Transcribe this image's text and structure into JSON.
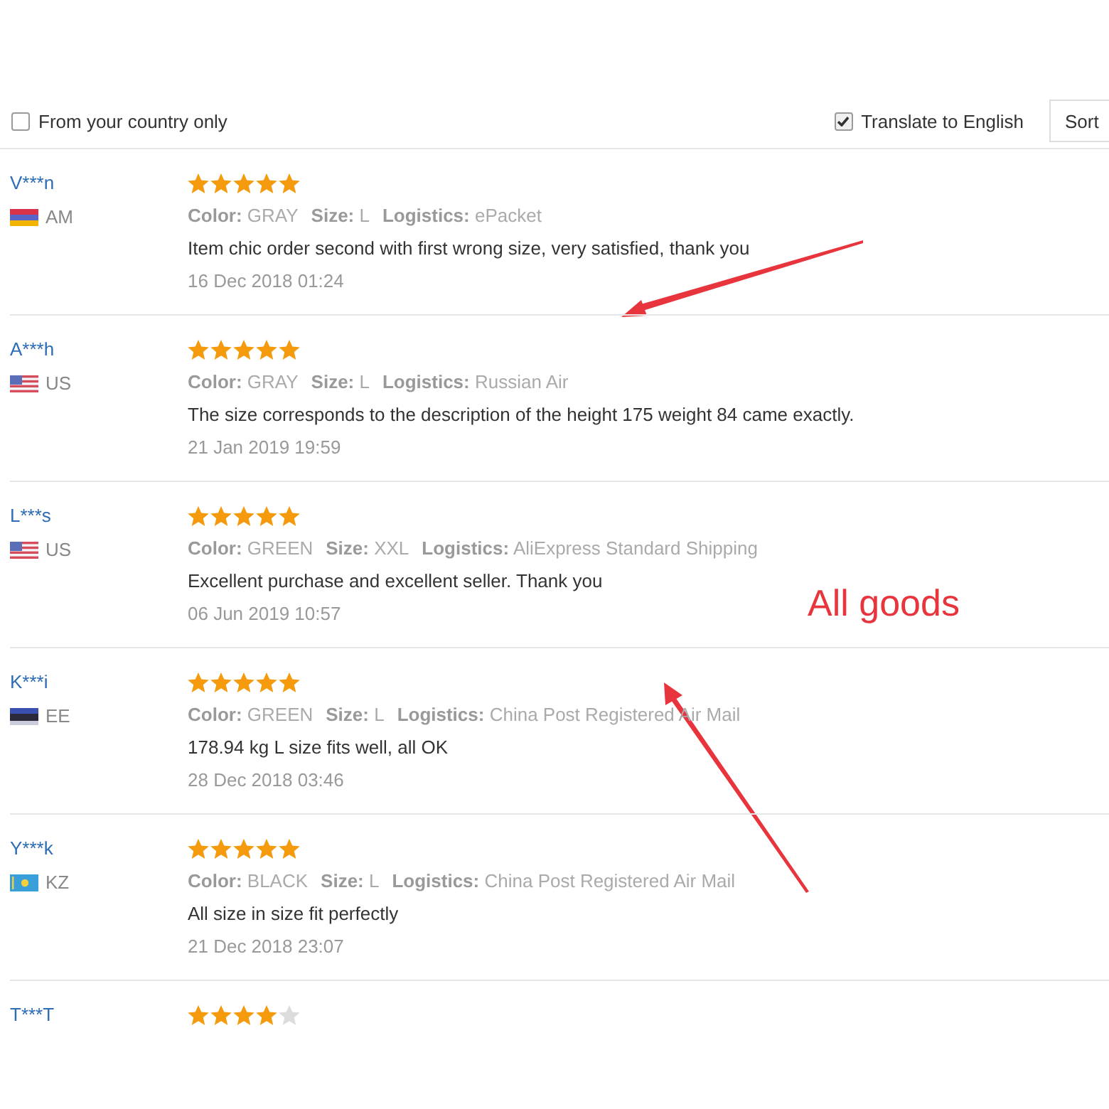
{
  "filters": [
    {
      "label": "From your country only",
      "checked": false
    },
    {
      "label": "Translate to English",
      "checked": true
    }
  ],
  "sort": {
    "label": "Sort"
  },
  "reviews": [
    {
      "name": "V***n",
      "flag": {
        "kind": "am"
      },
      "country": "AM",
      "stars": 5,
      "attributes": [
        {
          "label": "Color:",
          "value": "GRAY"
        },
        {
          "label": "Size:",
          "value": "L"
        },
        {
          "label": "Logistics:",
          "value": "ePacket"
        }
      ],
      "comment": "Item chic order second with first wrong size, very satisfied, thank you",
      "date": "16 Dec 2018 01:24"
    },
    {
      "name": "A***h",
      "flag": {
        "kind": "us"
      },
      "country": "US",
      "stars": 5,
      "attributes": [
        {
          "label": "Color:",
          "value": "GRAY"
        },
        {
          "label": "Size:",
          "value": "L"
        },
        {
          "label": "Logistics:",
          "value": "Russian Air"
        }
      ],
      "comment": "The size corresponds to the description of the height 175 weight 84 came exactly.",
      "date": "21 Jan 2019 19:59"
    },
    {
      "name": "L***s",
      "flag": {
        "kind": "us"
      },
      "country": "US",
      "stars": 5,
      "attributes": [
        {
          "label": "Color:",
          "value": "GREEN"
        },
        {
          "label": "Size:",
          "value": "XXL"
        },
        {
          "label": "Logistics:",
          "value": "AliExpress Standard Shipping"
        }
      ],
      "comment": "Excellent purchase and excellent seller. Thank you",
      "date": "06 Jun 2019 10:57"
    },
    {
      "name": "K***i",
      "flag": {
        "kind": "ee"
      },
      "country": "EE",
      "stars": 5,
      "attributes": [
        {
          "label": "Color:",
          "value": "GREEN"
        },
        {
          "label": "Size:",
          "value": "L"
        },
        {
          "label": "Logistics:",
          "value": "China Post Registered Air Mail"
        }
      ],
      "comment": "178.94 kg L size fits well, all OK",
      "date": "28 Dec 2018 03:46"
    },
    {
      "name": "Y***k",
      "flag": {
        "kind": "kz"
      },
      "country": "KZ",
      "stars": 5,
      "attributes": [
        {
          "label": "Color:",
          "value": "BLACK"
        },
        {
          "label": "Size:",
          "value": "L"
        },
        {
          "label": "Logistics:",
          "value": "China Post Registered Air Mail"
        }
      ],
      "comment": "All size in size fit perfectly",
      "date": "21 Dec 2018 23:07"
    },
    {
      "name": "T***T",
      "stars": 4
    }
  ],
  "annotation": {
    "text": "All goods"
  }
}
